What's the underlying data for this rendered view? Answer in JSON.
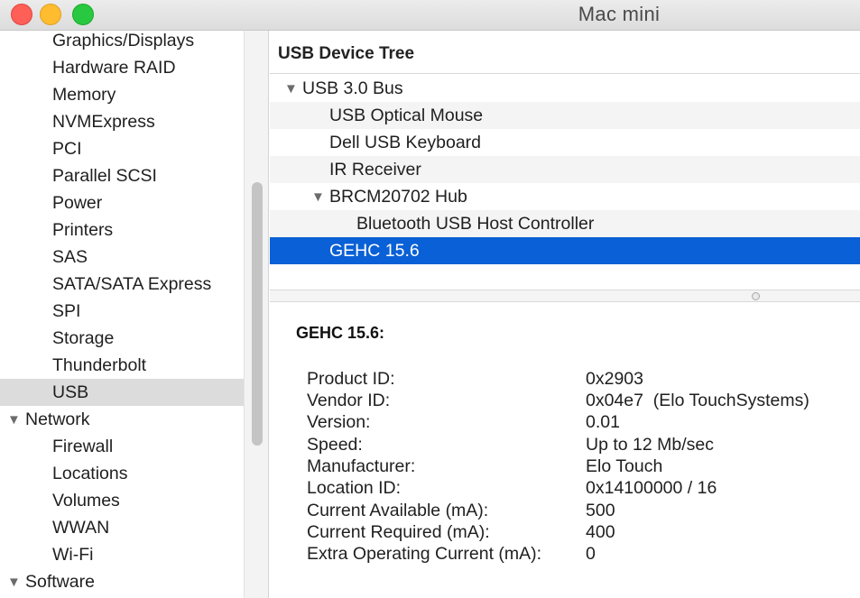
{
  "window": {
    "title": "Mac mini"
  },
  "sidebar": {
    "items": [
      {
        "label": "Graphics/Displays",
        "level": "child"
      },
      {
        "label": "Hardware RAID",
        "level": "child"
      },
      {
        "label": "Memory",
        "level": "child"
      },
      {
        "label": "NVMExpress",
        "level": "child"
      },
      {
        "label": "PCI",
        "level": "child"
      },
      {
        "label": "Parallel SCSI",
        "level": "child"
      },
      {
        "label": "Power",
        "level": "child"
      },
      {
        "label": "Printers",
        "level": "child"
      },
      {
        "label": "SAS",
        "level": "child"
      },
      {
        "label": "SATA/SATA Express",
        "level": "child"
      },
      {
        "label": "SPI",
        "level": "child"
      },
      {
        "label": "Storage",
        "level": "child"
      },
      {
        "label": "Thunderbolt",
        "level": "child"
      },
      {
        "label": "USB",
        "level": "child",
        "selected": true
      },
      {
        "label": "Network",
        "level": "parent",
        "expanded": true
      },
      {
        "label": "Firewall",
        "level": "child"
      },
      {
        "label": "Locations",
        "level": "child"
      },
      {
        "label": "Volumes",
        "level": "child"
      },
      {
        "label": "WWAN",
        "level": "child"
      },
      {
        "label": "Wi-Fi",
        "level": "child"
      },
      {
        "label": "Software",
        "level": "parent",
        "expanded": true
      }
    ],
    "expand_glyph": "▼"
  },
  "device_tree": {
    "header": "USB Device Tree",
    "rows": [
      {
        "label": "USB 3.0 Bus",
        "expandable": true
      },
      {
        "label": "USB Optical Mouse"
      },
      {
        "label": "Dell USB Keyboard"
      },
      {
        "label": "IR Receiver"
      },
      {
        "label": "BRCM20702 Hub",
        "expandable": true
      },
      {
        "label": "Bluetooth USB Host Controller"
      },
      {
        "label": "GEHC 15.6",
        "selected": true
      }
    ]
  },
  "details": {
    "title": "GEHC 15.6:",
    "properties": [
      {
        "label": "Product ID:",
        "value": "0x2903"
      },
      {
        "label": "Vendor ID:",
        "value": "0x04e7  (Elo TouchSystems)"
      },
      {
        "label": "Version:",
        "value": "0.01"
      },
      {
        "label": "Speed:",
        "value": "Up to 12 Mb/sec"
      },
      {
        "label": "Manufacturer:",
        "value": "Elo Touch"
      },
      {
        "label": "Location ID:",
        "value": "0x14100000 / 16"
      },
      {
        "label": "Current Available (mA):",
        "value": "500"
      },
      {
        "label": "Current Required (mA):",
        "value": "400"
      },
      {
        "label": "Extra Operating Current (mA):",
        "value": "0"
      }
    ]
  },
  "colors": {
    "selection": "#0a60d6",
    "sidebar_selection": "#dcdcdc",
    "close": "#fe5f57",
    "minimize": "#febc2e",
    "maximize": "#28c840"
  }
}
